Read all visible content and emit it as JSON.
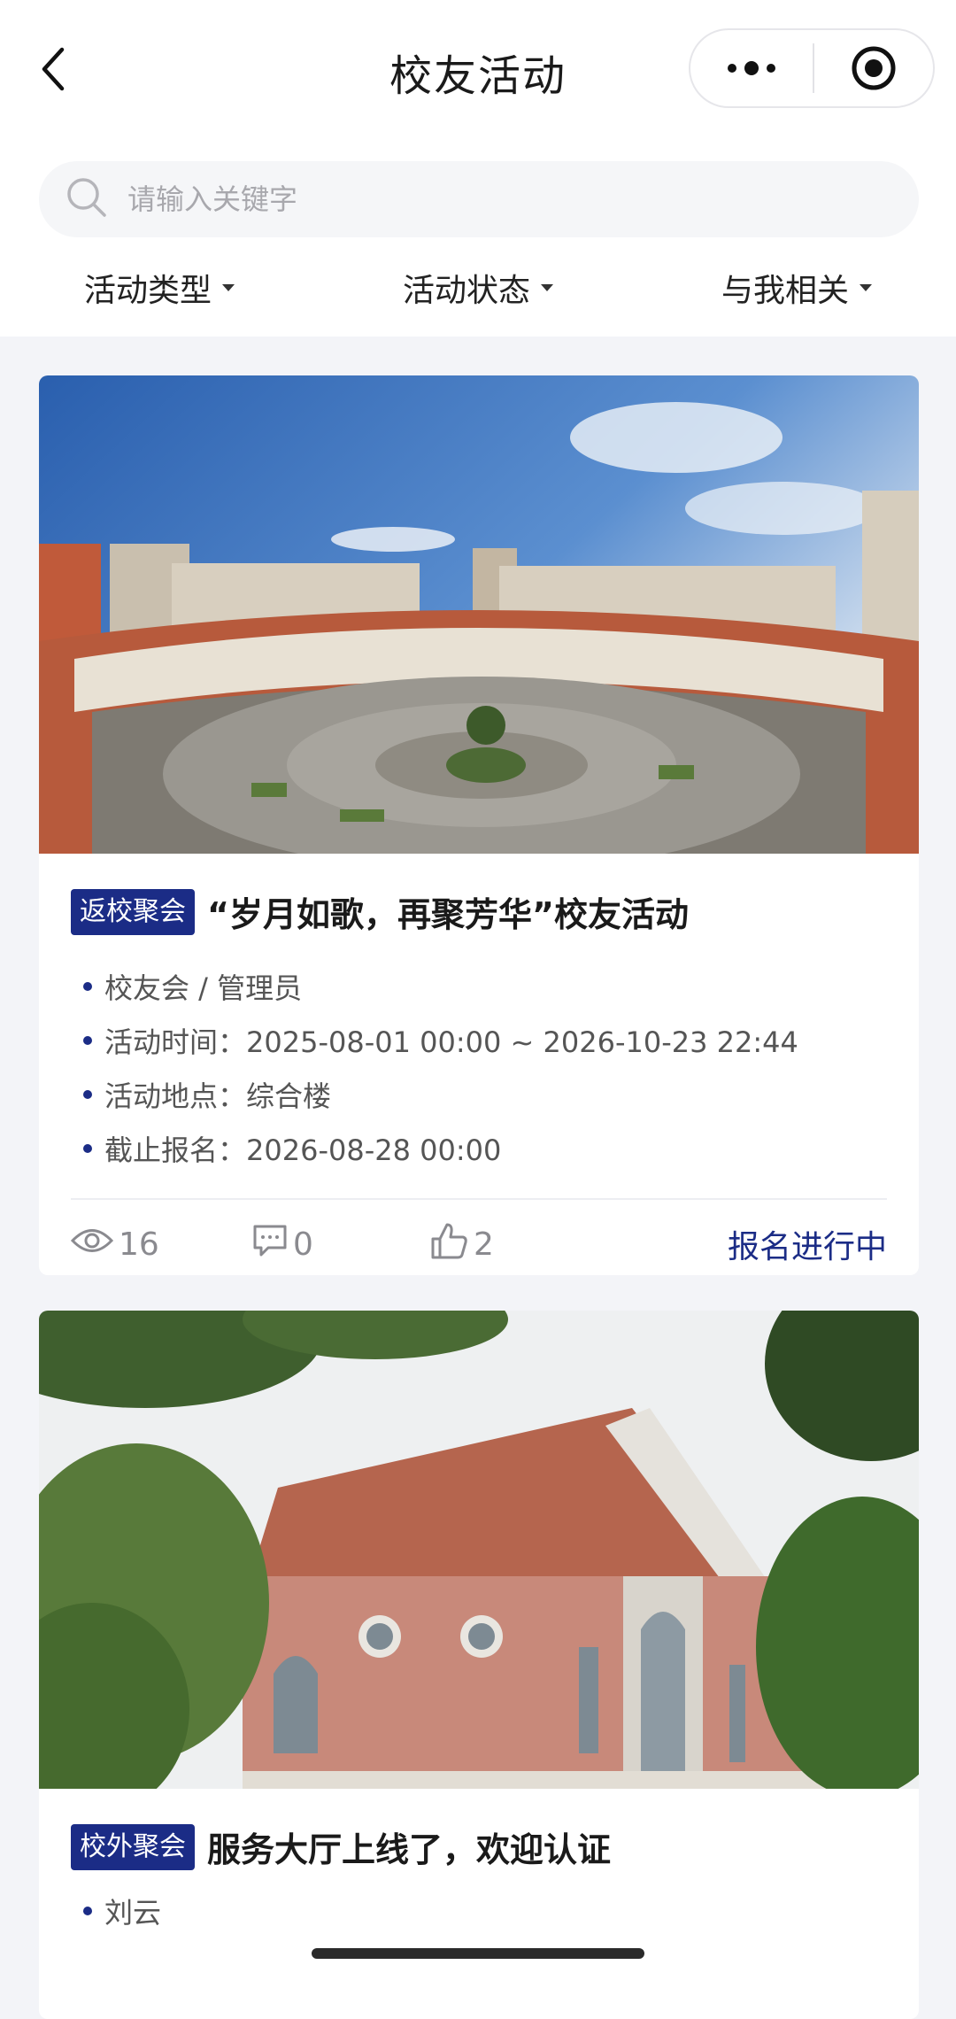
{
  "nav": {
    "title": "校友活动"
  },
  "search": {
    "placeholder": "请输入关键字"
  },
  "filters": [
    {
      "label": "活动类型"
    },
    {
      "label": "活动状态"
    },
    {
      "label": "与我相关"
    }
  ],
  "cards": [
    {
      "tag": "返校聚会",
      "title": "“岁月如歌，再聚芳华”校友活动",
      "info": [
        "校友会 / 管理员",
        "活动时间：2025-08-01 00:00 ~ 2026-10-23 22:44",
        "活动地点：综合楼",
        "截止报名：2026-08-28 00:00"
      ],
      "views": "16",
      "comments": "0",
      "likes": "2",
      "status": "报名进行中"
    },
    {
      "tag": "校外聚会",
      "title": "服务大厅上线了，欢迎认证",
      "info": [
        "刘云"
      ]
    }
  ],
  "colors": {
    "accent": "#1b2c86",
    "background": "#f3f4f8"
  }
}
